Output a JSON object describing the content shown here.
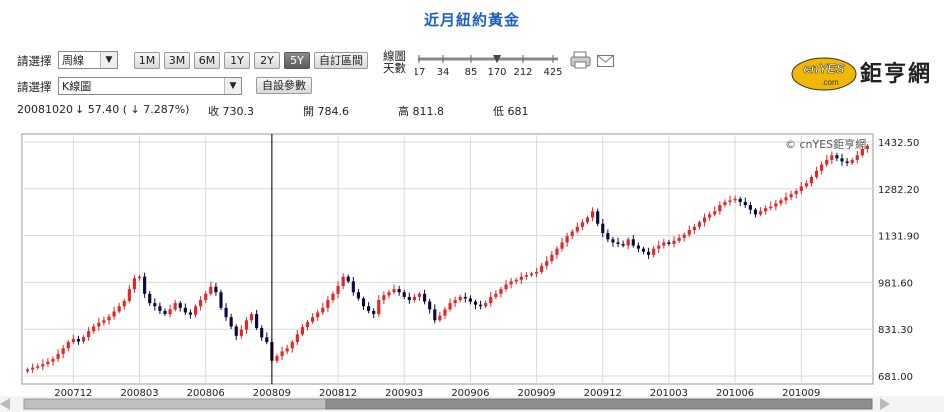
{
  "title": "近月紐約黃金",
  "controls": {
    "select_label_1": "請選擇",
    "period_value": "周線",
    "range_buttons": [
      "1M",
      "3M",
      "6M",
      "1Y",
      "2Y",
      "5Y",
      "自訂區間"
    ],
    "active_range": "5Y",
    "line_days_label_1": "線圖",
    "line_days_label_2": "天數",
    "line_days_ticks": [
      "17",
      "34",
      "85",
      "170",
      "212",
      "425"
    ],
    "line_days_selected": "170",
    "select_label_2": "請選擇",
    "chart_type_value": "K線圖",
    "params_button": "自設參數"
  },
  "stats": {
    "date": "20081020",
    "change": "↓ 57.40 ( ↓ 7.287%)",
    "close": "收 730.3",
    "open": "開 784.6",
    "high": "高 811.8",
    "low": "低 681"
  },
  "logo": {
    "brand": "cnYES",
    "domain": ".com",
    "name": "鉅亨網"
  },
  "colors": {
    "title": "#1f5fbf",
    "up": "#e32626",
    "down": "#0a0a3c",
    "grid": "#d9d9d9"
  },
  "chart_data": {
    "type": "candlestick",
    "watermark": "© cnYES鉅亨網",
    "y_ticks": [
      "1432.50",
      "1282.20",
      "1131.90",
      "981.60",
      "831.30",
      "681.00"
    ],
    "ylim": [
      681.0,
      1432.5
    ],
    "x_ticks": [
      "200712",
      "200803",
      "200806",
      "200809",
      "200812",
      "200903",
      "200906",
      "200909",
      "200912",
      "201003",
      "201006",
      "201009"
    ],
    "x_tick_index": [
      9,
      22,
      35,
      48,
      61,
      74,
      87,
      100,
      113,
      126,
      139,
      152
    ],
    "crosshair_index": 48,
    "close": [
      702,
      708,
      712,
      719,
      727,
      736,
      752,
      770,
      790,
      800,
      792,
      806,
      825,
      840,
      852,
      860,
      872,
      888,
      905,
      922,
      960,
      995,
      1000,
      945,
      915,
      905,
      890,
      880,
      895,
      915,
      900,
      885,
      878,
      905,
      925,
      945,
      968,
      950,
      900,
      870,
      840,
      810,
      830,
      860,
      880,
      835,
      805,
      790,
      730,
      745,
      760,
      770,
      790,
      815,
      838,
      855,
      870,
      885,
      900,
      925,
      945,
      970,
      1000,
      985,
      950,
      930,
      905,
      890,
      880,
      925,
      940,
      950,
      960,
      950,
      935,
      925,
      935,
      945,
      920,
      895,
      860,
      875,
      895,
      915,
      925,
      935,
      930,
      920,
      910,
      905,
      915,
      935,
      945,
      960,
      975,
      985,
      990,
      1000,
      1005,
      1010,
      1015,
      1035,
      1050,
      1070,
      1090,
      1110,
      1130,
      1145,
      1160,
      1175,
      1190,
      1210,
      1170,
      1140,
      1120,
      1110,
      1105,
      1100,
      1120,
      1100,
      1090,
      1080,
      1070,
      1090,
      1100,
      1110,
      1105,
      1115,
      1125,
      1135,
      1150,
      1160,
      1175,
      1190,
      1200,
      1210,
      1230,
      1240,
      1245,
      1250,
      1240,
      1230,
      1215,
      1200,
      1210,
      1220,
      1225,
      1235,
      1245,
      1255,
      1265,
      1275,
      1290,
      1300,
      1320,
      1340,
      1360,
      1375,
      1390,
      1380,
      1370,
      1365,
      1375,
      1390,
      1410,
      1420
    ]
  }
}
